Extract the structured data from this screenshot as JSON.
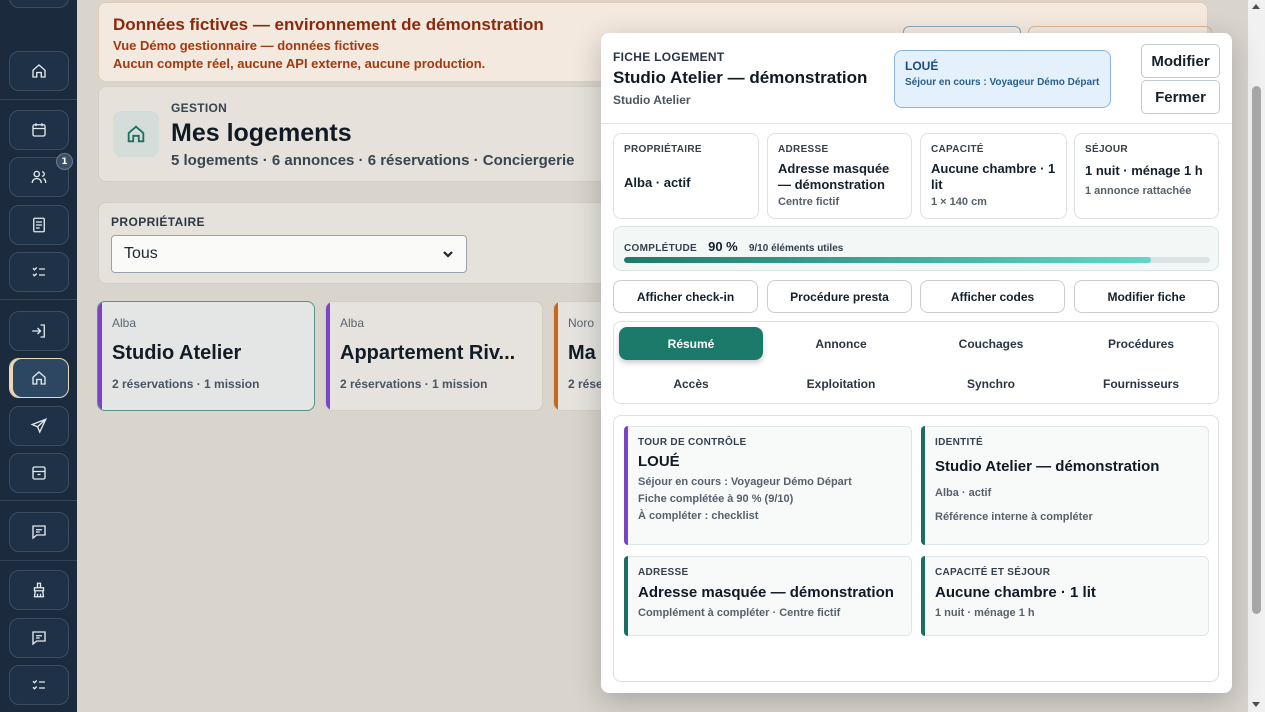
{
  "sidebar": {
    "badge_count": "1",
    "items": [
      {
        "icon": "home-icon"
      },
      {
        "icon": "calendar-icon"
      },
      {
        "icon": "users-icon"
      },
      {
        "icon": "document-icon"
      },
      {
        "icon": "checklist-icon"
      },
      {
        "icon": "login-icon"
      },
      {
        "icon": "home-icon",
        "active": true
      },
      {
        "icon": "send-icon"
      },
      {
        "icon": "archive-icon"
      },
      {
        "icon": "message-icon"
      },
      {
        "icon": "cleaning-icon"
      },
      {
        "icon": "message-icon"
      },
      {
        "icon": "checklist-icon"
      }
    ]
  },
  "banner": {
    "title": "Données fictives — environnement de démonstration",
    "line1": "Vue Démo gestionnaire — données fictives",
    "line2": "Aucun compte réel, aucune API externe, aucune production."
  },
  "gestion": {
    "eyebrow": "GESTION",
    "title": "Mes logements",
    "subtitle": "5 logements · 6 annonces · 6 réservations · Conciergerie"
  },
  "filter": {
    "label": "PROPRIÉTAIRE",
    "selected": "Tous"
  },
  "listing_cards": [
    {
      "owner": "Alba",
      "title": "Studio Atelier",
      "meta": "2 réservations · 1 mission",
      "accent": "#7a44c9"
    },
    {
      "owner": "Alba",
      "title": "Appartement Riv...",
      "meta": "2 réservations · 1 mission",
      "accent": "#7a44c9"
    },
    {
      "owner": "Noro",
      "title": "Ma",
      "meta": "2 rése",
      "accent": "#c9661e"
    }
  ],
  "panel": {
    "eyebrow": "FICHE LOGEMENT",
    "title": "Studio Atelier — démonstration",
    "subtitle": "Studio Atelier",
    "status": {
      "title": "LOUÉ",
      "desc": "Séjour en cours : Voyageur Démo Départ"
    },
    "modify_label": "Modifier",
    "close_label": "Fermer",
    "info": [
      {
        "label": "PROPRIÉTAIRE",
        "value": "Alba · actif",
        "sub": ""
      },
      {
        "label": "ADRESSE",
        "value": "Adresse masquée — démonstration",
        "sub": "Centre fictif"
      },
      {
        "label": "CAPACITÉ",
        "value": "Aucune chambre · 1 lit",
        "sub": "1 × 140 cm"
      },
      {
        "label": "SÉJOUR",
        "value": "1 nuit · ménage 1 h",
        "sub": "1 annonce rattachée"
      }
    ],
    "completion": {
      "label": "COMPLÉTUDE",
      "percent_text": "90 %",
      "detail": "9/10 éléments utiles",
      "value": 0.9
    },
    "actions": [
      {
        "label": "Afficher check-in",
        "name": "show-checkin-button"
      },
      {
        "label": "Procédure presta",
        "name": "provider-procedure-button"
      },
      {
        "label": "Afficher codes",
        "name": "show-codes-button"
      },
      {
        "label": "Modifier fiche",
        "name": "edit-sheet-button"
      }
    ],
    "tabs": [
      {
        "label": "Résumé",
        "active": true
      },
      {
        "label": "Annonce"
      },
      {
        "label": "Couchages"
      },
      {
        "label": "Procédures"
      },
      {
        "label": "Accès"
      },
      {
        "label": "Exploitation"
      },
      {
        "label": "Synchro"
      },
      {
        "label": "Fournisseurs"
      }
    ],
    "cards": [
      {
        "label": "TOUR DE CONTRÔLE",
        "value": "LOUÉ",
        "lines": [
          "Séjour en cours : Voyageur Démo Départ",
          "Fiche complétée à 90 % (9/10)",
          "À compléter : checklist"
        ],
        "accent": "#7a44c9"
      },
      {
        "label": "IDENTITÉ",
        "value": "Studio Atelier — démonstration",
        "lines": [
          "Alba · actif",
          "Référence interne à compléter"
        ],
        "accent": "#1b6e62"
      },
      {
        "label": "ADRESSE",
        "value": "Adresse masquée — démonstration",
        "lines": [
          "Complément à compléter · Centre fictif"
        ],
        "accent": "#1b6e62"
      },
      {
        "label": "CAPACITÉ ET SÉJOUR",
        "value": "Aucune chambre · 1 lit",
        "lines": [
          "1 nuit · ménage 1 h"
        ],
        "accent": "#1b6e62"
      }
    ]
  }
}
